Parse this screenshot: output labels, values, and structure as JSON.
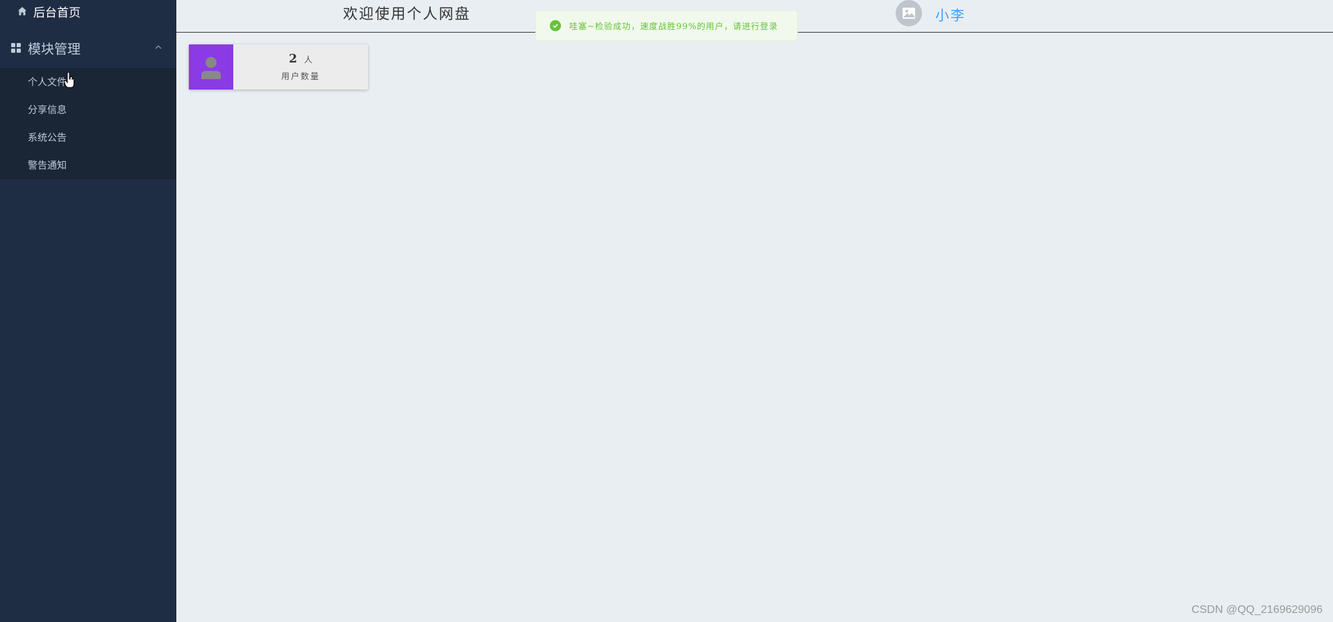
{
  "sidebar": {
    "home_label": "后台首页",
    "group_label": "模块管理",
    "items": [
      {
        "label": "个人文件"
      },
      {
        "label": "分享信息"
      },
      {
        "label": "系统公告"
      },
      {
        "label": "警告通知"
      }
    ]
  },
  "header": {
    "title": "欢迎使用个人网盘",
    "username": "小李",
    "avatar_icon": "image-placeholder-icon"
  },
  "toast": {
    "message": "哇塞~检验成功，速度战胜99%的用户，请进行登录",
    "type": "success"
  },
  "stat_card": {
    "value": "2",
    "unit": "人",
    "label": "用户数量",
    "icon": "user-icon",
    "accent_color": "#8a3be6"
  },
  "watermark": "CSDN @QQ_2169629096",
  "colors": {
    "sidebar_bg": "#1f2d44",
    "submenu_bg": "#1a2536",
    "page_bg": "#e9eef3",
    "link_blue": "#409eff",
    "success_green": "#67c23a"
  }
}
